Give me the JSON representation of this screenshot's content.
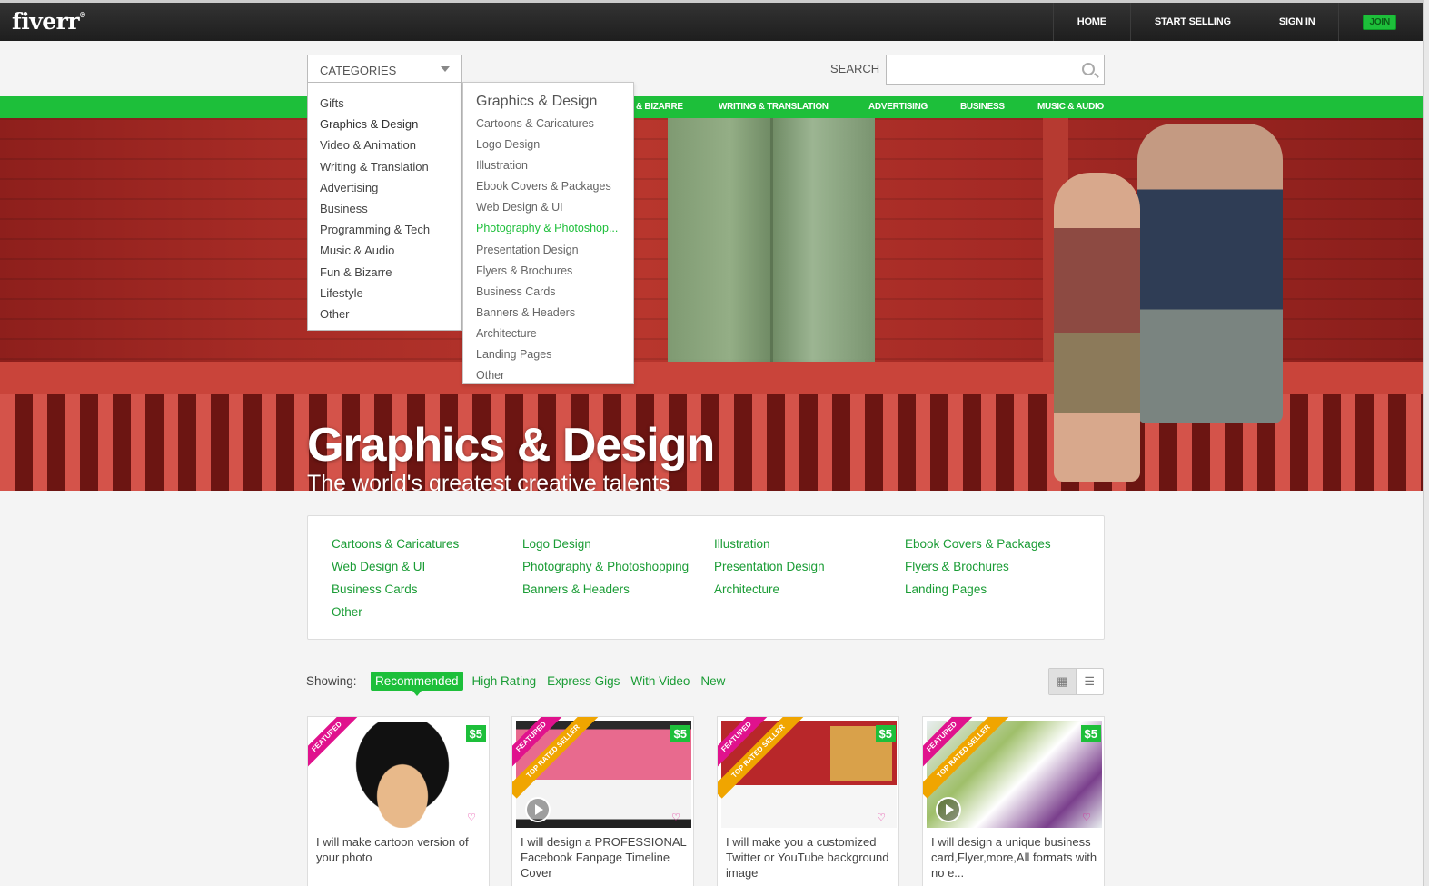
{
  "header": {
    "logo": "fiverr",
    "logo_mark": "®",
    "nav": [
      "HOME",
      "START SELLING",
      "SIGN IN"
    ],
    "join": "JOIN"
  },
  "search": {
    "categories_label": "CATEGORIES",
    "label": "SEARCH",
    "placeholder": ""
  },
  "category_bar": [
    "& BIZARRE",
    "WRITING & TRANSLATION",
    "ADVERTISING",
    "BUSINESS",
    "MUSIC & AUDIO"
  ],
  "categories_menu": [
    "Gifts",
    "Graphics & Design",
    "Video & Animation",
    "Writing & Translation",
    "Advertising",
    "Business",
    "Programming & Tech",
    "Music & Audio",
    "Fun & Bizarre",
    "Lifestyle",
    "Other"
  ],
  "submenu": {
    "heading": "Graphics & Design",
    "items": [
      "Cartoons & Caricatures",
      "Logo Design",
      "Illustration",
      "Ebook Covers & Packages",
      "Web Design & UI",
      "Photography & Photoshop...",
      "Presentation Design",
      "Flyers & Brochures",
      "Business Cards",
      "Banners & Headers",
      "Architecture",
      "Landing Pages",
      "Other"
    ],
    "highlighted": "Photography & Photoshop..."
  },
  "hero": {
    "title": "Graphics & Design",
    "subtitle": "The world's greatest creative talents"
  },
  "subcategories": [
    [
      "Cartoons & Caricatures",
      "Web Design & UI",
      "Business Cards",
      "Other"
    ],
    [
      "Logo Design",
      "Photography & Photoshopping",
      "Banners & Headers"
    ],
    [
      "Illustration",
      "Presentation Design",
      "Architecture"
    ],
    [
      "Ebook Covers & Packages",
      "Flyers & Brochures",
      "Landing Pages"
    ]
  ],
  "showing": {
    "label": "Showing:",
    "filters": [
      "Recommended",
      "High Rating",
      "Express Gigs",
      "With Video",
      "New"
    ],
    "active": "Recommended"
  },
  "gigs": [
    {
      "title": "I will make cartoon version of your photo",
      "price": "$5",
      "ribbons": [
        "FEATURED"
      ]
    },
    {
      "title": "I will design a PROFESSIONAL Facebook Fanpage Timeline Cover",
      "price": "$5",
      "ribbons": [
        "FEATURED",
        "TOP RATED SELLER"
      ]
    },
    {
      "title": "I will make you a customized Twitter or YouTube background image",
      "price": "$5",
      "ribbons": [
        "FEATURED",
        "TOP RATED SELLER"
      ]
    },
    {
      "title": "I will design a unique business card,Flyer,more,All formats with no e...",
      "price": "$5",
      "ribbons": [
        "FEATURED",
        "TOP RATED SELLER"
      ]
    }
  ],
  "colors": {
    "accent": "#1dbf3a",
    "link": "#1a9c35",
    "featured": "#e0128d",
    "top_rated": "#f0a500",
    "header_bg": "#1e1e1e"
  },
  "icons": [
    "search-icon",
    "chevron-down-icon",
    "heart-icon",
    "play-icon",
    "grid-view-icon",
    "list-view-icon"
  ]
}
